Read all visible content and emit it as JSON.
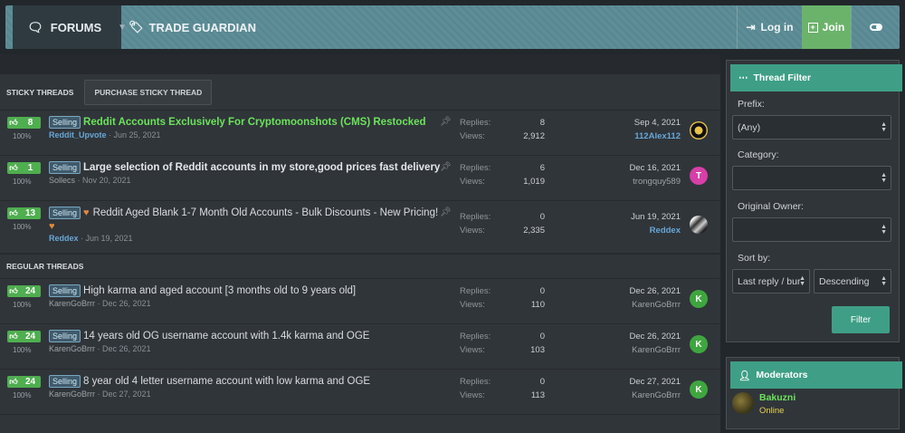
{
  "header": {
    "forums_label": "FORUMS",
    "section_label": "TRADE GUARDIAN",
    "login_label": "Log in",
    "join_label": "Join"
  },
  "sticky": {
    "title": "STICKY THREADS",
    "purchase_label": "PURCHASE STICKY THREAD",
    "threads": [
      {
        "votes": "8",
        "pct": "100%",
        "badge": "Selling",
        "title": "Reddit Accounts Exclusively For Cryptomoonshots (CMS) Restocked",
        "author": "Reddit_Upvote",
        "date": "Jun 25, 2021",
        "replies": "8",
        "views": "2,912",
        "last_date": "Sep 4, 2021",
        "last_user": "112Alex112"
      },
      {
        "votes": "1",
        "pct": "100%",
        "badge": "Selling",
        "title": "Large selection of Reddit accounts in my store,good prices fast delivery",
        "author": "Sollecs",
        "date": "Nov 20, 2021",
        "replies": "6",
        "views": "1,019",
        "last_date": "Dec 16, 2021",
        "last_user": "trongquy589",
        "avatar_letter": "T"
      },
      {
        "votes": "13",
        "pct": "100%",
        "badge": "Selling",
        "title": "Reddit Aged Blank 1-7 Month Old Accounts - Bulk Discounts - New Pricing!",
        "author": "Reddex",
        "date": "Jun 19, 2021",
        "replies": "0",
        "views": "2,335",
        "last_date": "Jun 19, 2021",
        "last_user": "Reddex"
      }
    ]
  },
  "regular": {
    "title": "REGULAR THREADS",
    "threads": [
      {
        "votes": "24",
        "pct": "100%",
        "badge": "Selling",
        "title": "High karma and aged account [3 months old to 9 years old]",
        "author": "KarenGoBrrr",
        "date": "Dec 26, 2021",
        "replies": "0",
        "views": "110",
        "last_date": "Dec 26, 2021",
        "last_user": "KarenGoBrrr",
        "avatar_letter": "K"
      },
      {
        "votes": "24",
        "pct": "100%",
        "badge": "Selling",
        "title": "14 years old OG username account with 1.4k karma and OGE",
        "author": "KarenGoBrrr",
        "date": "Dec 26, 2021",
        "replies": "0",
        "views": "103",
        "last_date": "Dec 26, 2021",
        "last_user": "KarenGoBrrr",
        "avatar_letter": "K"
      },
      {
        "votes": "24",
        "pct": "100%",
        "badge": "Selling",
        "title": "8 year old 4 letter username account with low karma and OGE",
        "author": "KarenGoBrrr",
        "date": "Dec 27, 2021",
        "replies": "0",
        "views": "113",
        "last_date": "Dec 27, 2021",
        "last_user": "KarenGoBrrr",
        "avatar_letter": "K"
      }
    ]
  },
  "labels": {
    "replies": "Replies:",
    "views": "Views:",
    "sep": " · "
  },
  "filter": {
    "title": "Thread Filter",
    "prefix_label": "Prefix:",
    "prefix_value": "(Any)",
    "category_label": "Category:",
    "category_value": "",
    "owner_label": "Original Owner:",
    "owner_value": "",
    "sort_label": "Sort by:",
    "sort_value": "Last reply / bur",
    "order_value": "Descending",
    "button_label": "Filter"
  },
  "moderators": {
    "title": "Moderators",
    "name": "Bakuzni",
    "status": "Online"
  },
  "colors": {
    "accent": "#3e9f86",
    "vote_green": "#4fae4f",
    "link_blue": "#67a7d6",
    "title_green": "#6be35a",
    "avatar_pink": "#d63fa8",
    "avatar_green": "#3fa63f"
  }
}
